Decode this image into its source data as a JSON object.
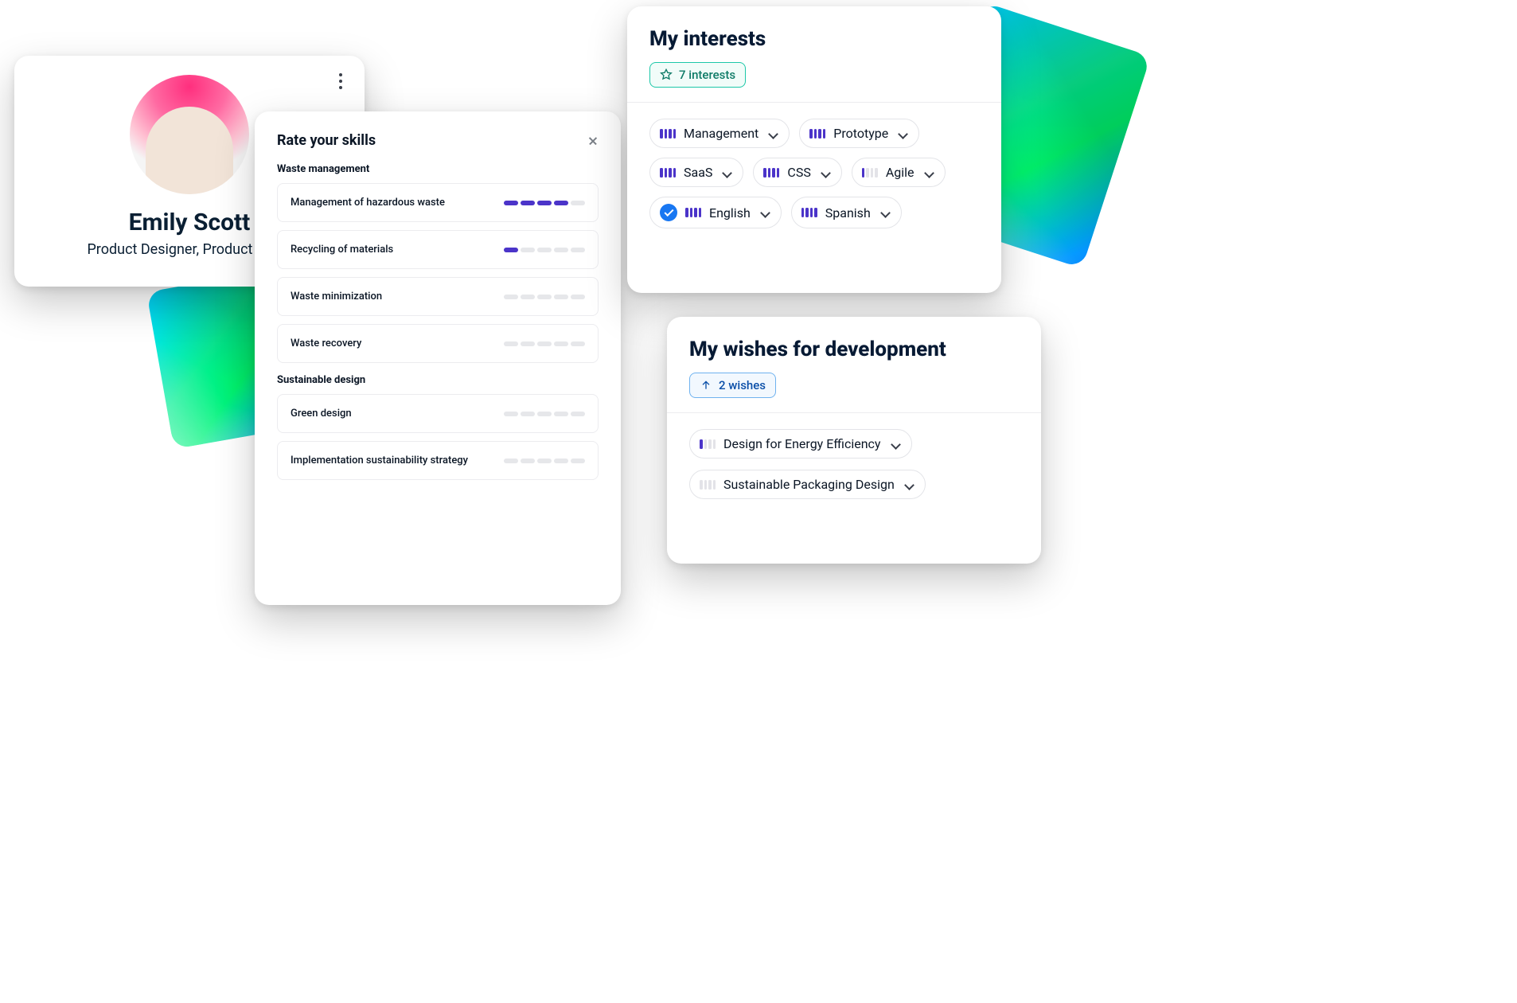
{
  "profile": {
    "name": "Emily Scott",
    "role": "Product Designer, Product  Team"
  },
  "skills_modal": {
    "title": "Rate your skills",
    "groups": [
      {
        "name": "Waste management",
        "items": [
          {
            "label": "Management of hazardous waste",
            "level": 4
          },
          {
            "label": "Recycling of materials",
            "level": 1
          },
          {
            "label": "Waste minimization",
            "level": 0
          },
          {
            "label": "Waste recovery",
            "level": 0
          }
        ]
      },
      {
        "name": "Sustainable design",
        "items": [
          {
            "label": "Green design",
            "level": 0
          },
          {
            "label": "Implementation sustainability strategy",
            "level": 0
          }
        ]
      }
    ]
  },
  "interests": {
    "title": "My interests",
    "badge_label": "7 interests",
    "items": [
      {
        "label": "Management",
        "level": 4,
        "verified": false
      },
      {
        "label": "Prototype",
        "level": 4,
        "verified": false
      },
      {
        "label": "SaaS",
        "level": 4,
        "verified": false
      },
      {
        "label": "CSS",
        "level": 4,
        "verified": false
      },
      {
        "label": "Agile",
        "level": 1,
        "verified": false
      },
      {
        "label": "English",
        "level": 4,
        "verified": true
      },
      {
        "label": "Spanish",
        "level": 4,
        "verified": false
      }
    ]
  },
  "wishes": {
    "title": "My wishes for development",
    "badge_label": "2 wishes",
    "items": [
      {
        "label": "Design for Energy Efficiency",
        "level": 1
      },
      {
        "label": "Sustainable Packaging Design",
        "level": 0
      }
    ]
  },
  "colors": {
    "accent": "#4b34c9",
    "text": "#0b1625"
  }
}
